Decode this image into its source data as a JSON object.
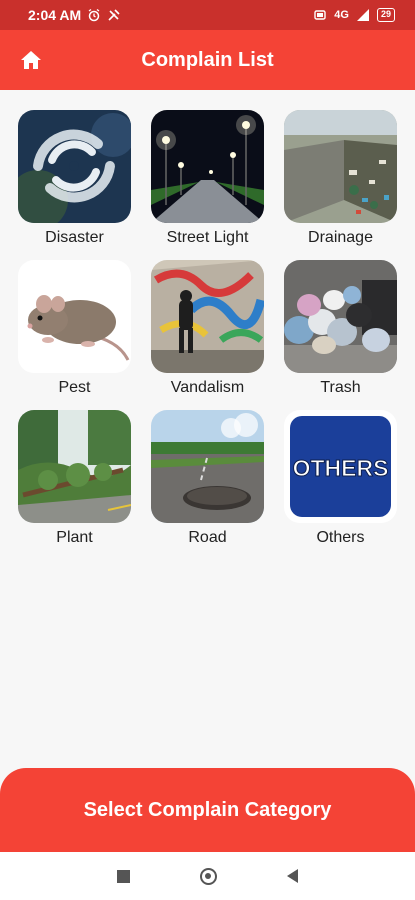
{
  "status_bar": {
    "time": "2:04 AM",
    "signal": "4G",
    "battery": "29"
  },
  "app_bar": {
    "title": "Complain List",
    "home_icon": "home-icon"
  },
  "categories": [
    {
      "label": "Disaster",
      "icon": "hurricane-satellite-image"
    },
    {
      "label": "Street Light",
      "icon": "street-lights-night-image"
    },
    {
      "label": "Drainage",
      "icon": "clogged-drain-image"
    },
    {
      "label": "Pest",
      "icon": "rat-image"
    },
    {
      "label": "Vandalism",
      "icon": "graffiti-wall-image"
    },
    {
      "label": "Trash",
      "icon": "trash-bags-image"
    },
    {
      "label": "Plant",
      "icon": "fallen-tree-image"
    },
    {
      "label": "Road",
      "icon": "pothole-road-image"
    },
    {
      "label": "Others",
      "icon": "others-sign-image",
      "sign_text": "OTHERS"
    }
  ],
  "bottom_button": {
    "label": "Select Complain Category"
  },
  "colors": {
    "primary": "#f44336",
    "status_bar": "#c9302c",
    "others_blue": "#1b3f9a"
  }
}
